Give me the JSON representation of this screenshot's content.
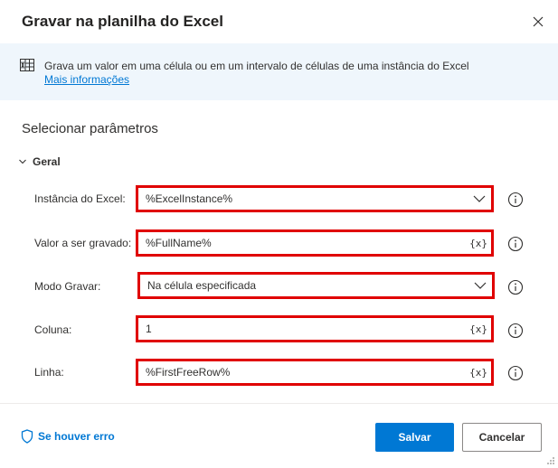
{
  "dialog": {
    "title": "Gravar na planilha do Excel",
    "close_icon": "close-icon"
  },
  "info": {
    "icon": "excel-icon",
    "description": "Grava um valor em uma célula ou em um intervalo de células de uma instância do Excel",
    "link": "Mais informações"
  },
  "section": {
    "title": "Selecionar parâmetros",
    "group_label": "Geral"
  },
  "params": [
    {
      "label": "Instância do Excel:",
      "value": "%ExcelInstance%",
      "control": "dropdown"
    },
    {
      "label": "Valor a ser gravado:",
      "value": "%FullName%",
      "control": "variable",
      "var_button": "{x}"
    },
    {
      "label": "Modo Gravar:",
      "value": "Na célula especificada",
      "control": "dropdown"
    },
    {
      "label": "Coluna:",
      "value": "1",
      "control": "variable",
      "var_button": "{x}"
    },
    {
      "label": "Linha:",
      "value": "%FirstFreeRow%",
      "control": "variable",
      "var_button": "{x}"
    }
  ],
  "footer": {
    "on_error": "Se houver erro",
    "save": "Salvar",
    "cancel": "Cancelar"
  },
  "colors": {
    "accent": "#0078d4",
    "highlight_border": "#e00000",
    "banner_bg": "#eff6fc"
  }
}
